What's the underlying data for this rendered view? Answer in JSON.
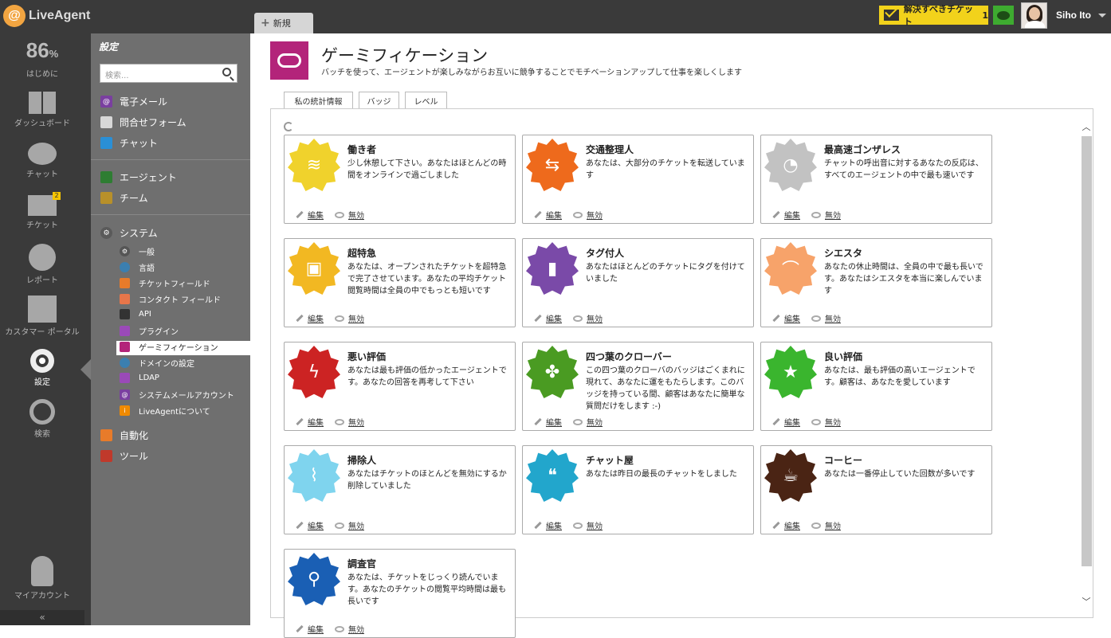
{
  "topbar": {
    "logo": "LiveAgent",
    "new_tab": "新規",
    "ticket_button": "解決すべきチケット",
    "ticket_count": "1",
    "user_name": "Siho Ito"
  },
  "leftnav": {
    "progress_value": "86",
    "progress_unit": "%",
    "progress_label": "はじめに",
    "items": [
      {
        "label": "ダッシュボード"
      },
      {
        "label": "チャット"
      },
      {
        "label": "チケット",
        "badge": "2"
      },
      {
        "label": "レポート"
      },
      {
        "label": "カスタマー ポータル"
      },
      {
        "label": "設定"
      },
      {
        "label": "検索"
      },
      {
        "label": "マイアカウント"
      }
    ],
    "collapse": "«"
  },
  "sidebar": {
    "title": "設定",
    "search_placeholder": "検索...",
    "group1": [
      "電子メール",
      "問合せフォーム",
      "チャット"
    ],
    "group2": [
      "エージェント",
      "チーム"
    ],
    "system": "システム",
    "system_items": [
      "一般",
      "言語",
      "チケットフィールド",
      "コンタクト フィールド",
      "API",
      "プラグイン",
      "ゲーミフィケーション",
      "ドメインの設定",
      "LDAP",
      "システムメールアカウント",
      "LiveAgentについて"
    ],
    "automation": "自動化",
    "tools": "ツール",
    "selected_item": "ゲーミフィケーション"
  },
  "main": {
    "title": "ゲーミフィケーション",
    "description": "バッチを使って、エージェントが楽しみながらお互いに競争することでモチベーションアップして仕事を楽しくします",
    "tabs": [
      "私の統計情報",
      "バッジ",
      "レベル"
    ],
    "edit_label": "編集",
    "disable_label": "無効",
    "badges": [
      {
        "title": "働き者",
        "desc": "少し休憩して下さい。あなたはほとんどの時間をオンラインで過ごしました",
        "color": "#f0d22c",
        "icon": "bee-icon"
      },
      {
        "title": "交通整理人",
        "desc": "あなたは、大部分のチケットを転送しています",
        "color": "#ee6a1c",
        "icon": "road-sign-icon"
      },
      {
        "title": "最高速ゴンザレス",
        "desc": "チャットの呼出音に対するあなたの反応は、すべてのエージェントの中で最も速いです",
        "color": "#c2c2c2",
        "icon": "speedometer-icon"
      },
      {
        "title": "超特急",
        "desc": "あなたは、オープンされたチケットを超特急で完了させています。あなたの平均チケット閲覧時間は全員の中でもっとも短いです",
        "color": "#f2b822",
        "icon": "train-icon"
      },
      {
        "title": "タグ付人",
        "desc": "あなたはほとんどのチケットにタグを付けていました",
        "color": "#7a4aa8",
        "icon": "stamp-icon"
      },
      {
        "title": "シエスタ",
        "desc": "あなたの休止時間は、全員の中で最も長いです。あなたはシエスタを本当に楽しんでいます",
        "color": "#f7a36a",
        "icon": "sombrero-icon"
      },
      {
        "title": "悪い評価",
        "desc": "あなたは最も評価の低かったエージェントです。あなたの回答を再考して下さい",
        "color": "#cc2323",
        "icon": "lightning-icon"
      },
      {
        "title": "四つ葉のクローバー",
        "desc": "この四つ葉のクローバのバッジはごくまれに現れて、あなたに運をもたらします。このバッジを持っている間、顧客はあなたに簡単な質問だけをします :-)",
        "color": "#4a9b22",
        "icon": "clover-icon"
      },
      {
        "title": "良い評価",
        "desc": "あなたは、最も評価の高いエージェントです。顧客は、あなたを愛しています",
        "color": "#3ab52e",
        "icon": "star-icon"
      },
      {
        "title": "掃除人",
        "desc": "あなたはチケットのほとんどを無効にするか削除していました",
        "color": "#7fd4ee",
        "icon": "brush-icon"
      },
      {
        "title": "チャット屋",
        "desc": "あなたは昨日の最長のチャットをしました",
        "color": "#22a6cc",
        "icon": "chat-bubbles-icon"
      },
      {
        "title": "コーヒー",
        "desc": "あなたは一番停止していた回数が多いです",
        "color": "#4a2414",
        "icon": "coffee-icon"
      },
      {
        "title": "調査官",
        "desc": "あなたは、チケットをじっくり読んでいます。あなたのチケットの閲覧平均時間は最も長いです",
        "color": "#1a5fb4",
        "icon": "magnifier-icon"
      }
    ]
  }
}
